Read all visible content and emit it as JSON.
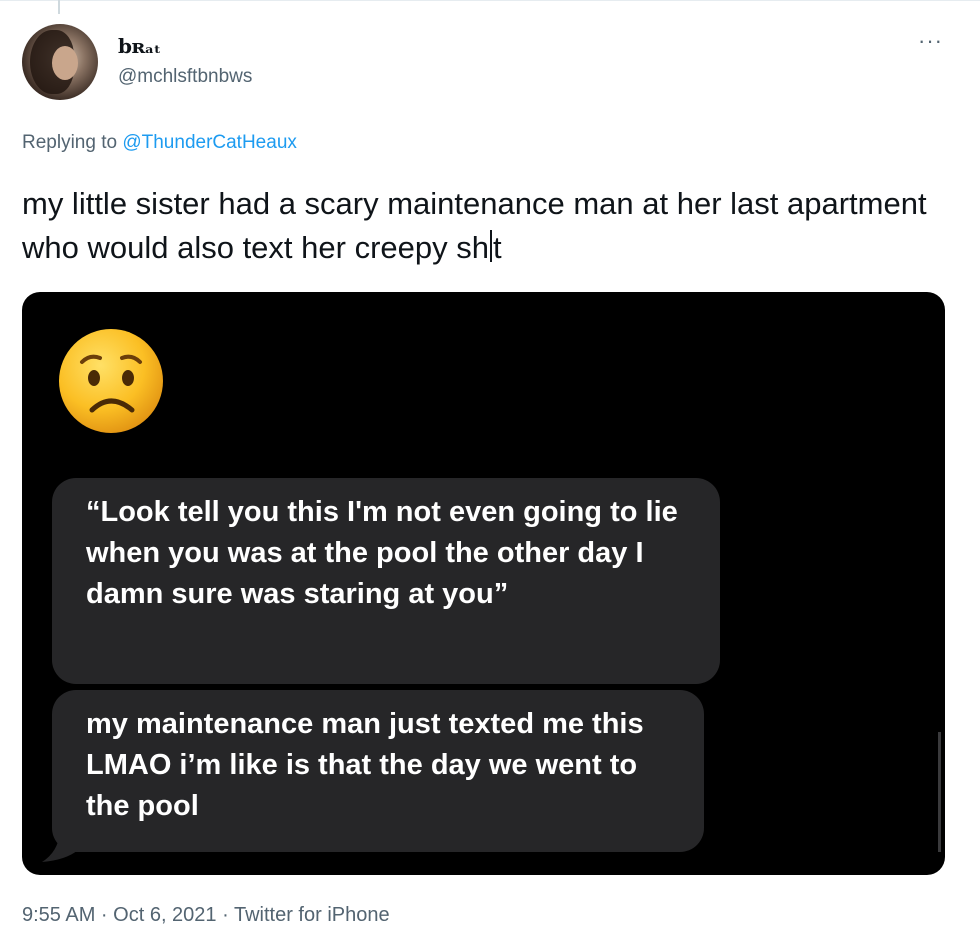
{
  "author": {
    "display_name": "bʀₐₜ",
    "handle": "@mchlsftbnbws"
  },
  "more_label": "···",
  "reply": {
    "prefix": "Replying to ",
    "mention": "@ThunderCatHeaux"
  },
  "tweet": {
    "text_before_caret": "my little sister had a scary maintenance man at her last apartment who would also text her creepy sh",
    "text_after_caret": "t"
  },
  "media": {
    "emoji": "worried-face",
    "messages": [
      "“Look tell you this I'm not even going to lie when you was at the pool the other day I damn sure was staring at you”",
      "my maintenance man just texted me this LMAO i’m like is that the day we went to the pool"
    ]
  },
  "meta": {
    "timestamp": "9:55 AM · Oct 6, 2021 · Twitter for iPhone"
  },
  "colors": {
    "link": "#1d9bf0",
    "secondary_text": "#536471",
    "bubble": "#262628",
    "media_bg": "#000000"
  }
}
